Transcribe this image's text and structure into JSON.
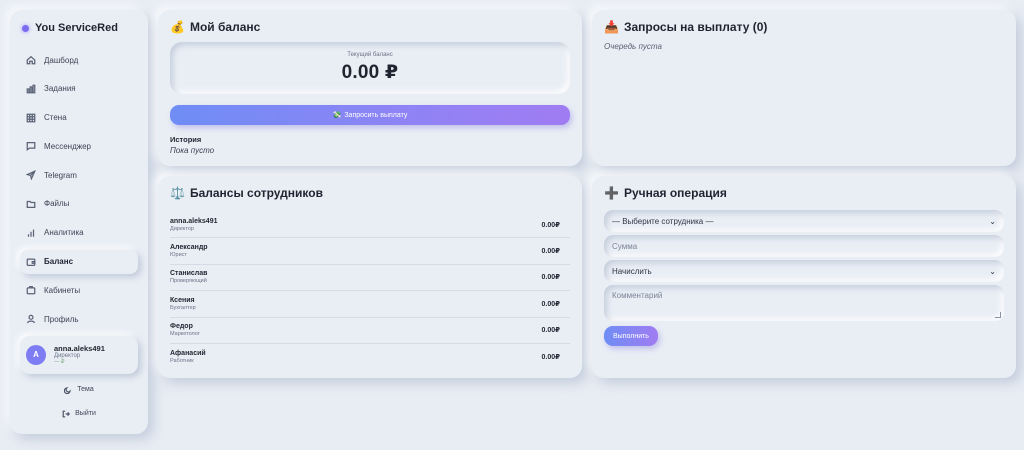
{
  "sidebar": {
    "brand": "You ServiceRed",
    "items": [
      {
        "label": "Дашборд",
        "icon": "home-icon"
      },
      {
        "label": "Задания",
        "icon": "bar-chart-icon"
      },
      {
        "label": "Стена",
        "icon": "grid-icon"
      },
      {
        "label": "Мессенджер",
        "icon": "chat-icon"
      },
      {
        "label": "Telegram",
        "icon": "send-icon"
      },
      {
        "label": "Файлы",
        "icon": "folder-icon"
      },
      {
        "label": "Аналитика",
        "icon": "analytics-icon"
      },
      {
        "label": "Баланс",
        "icon": "wallet-icon",
        "active": true
      },
      {
        "label": "Кабинеты",
        "icon": "briefcase-icon"
      },
      {
        "label": "Профиль",
        "icon": "user-icon"
      }
    ],
    "user": {
      "avatar_letter": "A",
      "name": "anna.aleks491",
      "role": "Директор",
      "status": "— ₽"
    },
    "theme_label": "Тема",
    "logout_label": "Выйти"
  },
  "balance": {
    "title": "Мой баланс",
    "current_label": "Текущий баланс",
    "value": "0.00 ₽",
    "payout_button": "Запросить выплату",
    "history_title": "История",
    "history_empty": "Пока пусто"
  },
  "requests": {
    "title": "Запросы на выплату (0)",
    "empty": "Очередь пуста"
  },
  "employees": {
    "title": "Балансы сотрудников",
    "rows": [
      {
        "name": "anna.aleks491",
        "role": "Директор",
        "amount": "0.00₽"
      },
      {
        "name": "Александр",
        "role": "Юрист",
        "amount": "0.00₽"
      },
      {
        "name": "Станислав",
        "role": "Проверяющий",
        "amount": "0.00₽"
      },
      {
        "name": "Ксения",
        "role": "Бухгалтер",
        "amount": "0.00₽"
      },
      {
        "name": "Федор",
        "role": "Маркетолог",
        "amount": "0.00₽"
      },
      {
        "name": "Афанасий",
        "role": "Работник",
        "amount": "0.00₽"
      }
    ]
  },
  "manual": {
    "title": "Ручная операция",
    "employee_select": "— Выберите сотрудника —",
    "sum_placeholder": "Сумма",
    "operation_select": "Начислить",
    "comment_placeholder": "Комментарий",
    "submit": "Выполнить"
  },
  "colors": {
    "accent": "#8f83f5",
    "background": "#e8edf4"
  }
}
